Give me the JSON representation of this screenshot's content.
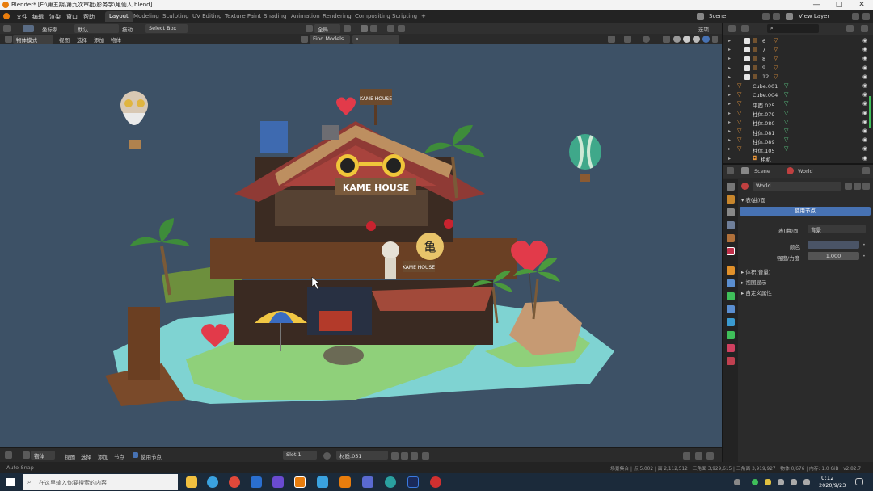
{
  "window": {
    "title": "Blender* [E:\\第五期\\第九次审批\\影务学\\龟仙人.blend]",
    "controls": [
      "—",
      "□",
      "✕"
    ]
  },
  "menu": [
    "文件",
    "编辑",
    "渲染",
    "窗口",
    "帮助"
  ],
  "workspaces": [
    "Layout",
    "Modeling",
    "Sculpting",
    "UV Editing",
    "Texture Paint",
    "Shading",
    "Animation",
    "Rendering",
    "Compositing",
    "Scripting"
  ],
  "active_workspace": "Layout",
  "scene": {
    "label": "Scene",
    "view_layer": "View Layer"
  },
  "viewport_header": {
    "coord_label": "坐标系",
    "coord_value": "默认",
    "drag_label": "拖动",
    "select_mode": "Select Box",
    "transform": "全局",
    "options": "选项"
  },
  "viewport_header2": {
    "mode": "物体模式",
    "view": "视图",
    "select": "选择",
    "add": "添加",
    "object": "物体",
    "find_models": "Find Models"
  },
  "scene_signs": {
    "roof_sign": "KAME HOUSE",
    "top_sign": "KAME HOUSE",
    "balcony_sign": "KAME HOUSE",
    "kame_char": "亀"
  },
  "outliner": {
    "rows": [
      {
        "name": "6",
        "type": "collection"
      },
      {
        "name": "7",
        "type": "collection"
      },
      {
        "name": "8",
        "type": "collection"
      },
      {
        "name": "9",
        "type": "collection"
      },
      {
        "name": "12",
        "type": "collection"
      },
      {
        "name": "Cube.001",
        "type": "mesh"
      },
      {
        "name": "Cube.004",
        "type": "mesh"
      },
      {
        "name": "平面.025",
        "type": "mesh"
      },
      {
        "name": "柱体.079",
        "type": "mesh"
      },
      {
        "name": "柱体.080",
        "type": "mesh"
      },
      {
        "name": "柱体.081",
        "type": "mesh"
      },
      {
        "name": "柱体.089",
        "type": "mesh"
      },
      {
        "name": "柱体.105",
        "type": "mesh"
      },
      {
        "name": "相机",
        "type": "camera"
      }
    ]
  },
  "properties": {
    "breadcrumb_scene": "Scene",
    "breadcrumb_world": "World",
    "world_name": "World",
    "section_surface": "表(曲)面",
    "use_nodes": "使用节点",
    "surface_label": "表(曲)面",
    "surface_value": "背景",
    "color_label": "颜色",
    "strength_label": "强度/力度",
    "strength_value": "1.000",
    "sections": [
      "体积(音量)",
      "视图显示",
      "自定义属性"
    ]
  },
  "timeline": {
    "mode": "物体",
    "view": "视图",
    "select": "选择",
    "add": "添加",
    "node": "节点",
    "use_nodes": "使用节点",
    "slot": "Slot 1",
    "material": "材质.051"
  },
  "statusbar": {
    "left": "Auto-Snap",
    "right": "场景集合 | 点 5,002 | 面 2,112,512 | 三角面 3,929,615 | 三角面 3,919,927 | 物体 0/676 | 内存: 1.0 GiB | v2.82.7"
  },
  "taskbar": {
    "search_placeholder": "在这里输入你要搜索的内容",
    "time": "0:12",
    "date": "2020/9/23"
  },
  "colors": {
    "viewport_bg": "#3d5166",
    "accent": "#4772b3",
    "mesh_icon": "#e8953a",
    "modifier_icon": "#5fd38a"
  }
}
